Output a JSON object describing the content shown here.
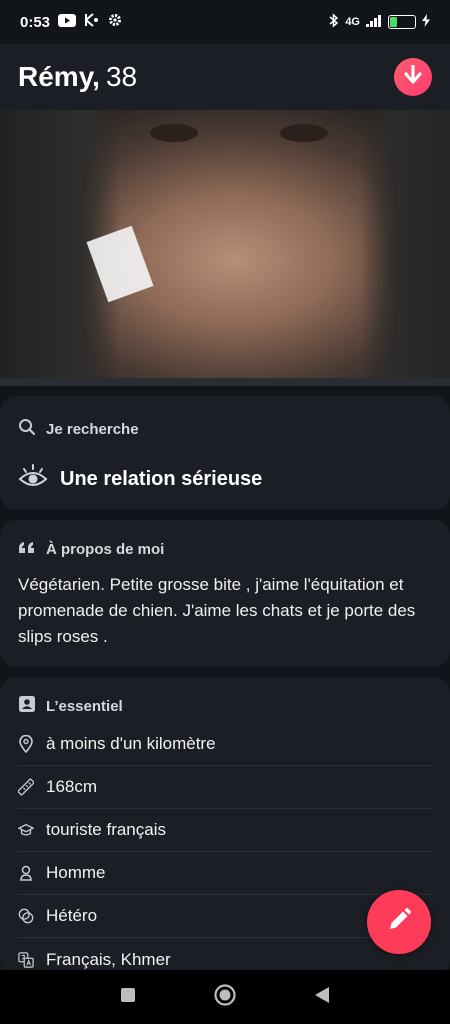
{
  "status_bar": {
    "time": "0:53",
    "network": "4G",
    "battery": "25"
  },
  "profile": {
    "name": "Rémy,",
    "age": "38"
  },
  "looking_for": {
    "label": "Je recherche",
    "value": "Une relation sérieuse"
  },
  "about": {
    "label": "À propos de moi",
    "text": " Végétarien. Petite grosse bite , j'aime l'équitation et promenade de chien. J'aime les chats et je porte des slips roses ."
  },
  "essentials": {
    "label": "L’essentiel",
    "items": [
      {
        "icon": "location-pin-icon",
        "text": "à moins d'un kilomètre"
      },
      {
        "icon": "ruler-icon",
        "text": "168cm"
      },
      {
        "icon": "graduation-cap-icon",
        "text": "touriste français"
      },
      {
        "icon": "person-icon",
        "text": "Homme"
      },
      {
        "icon": "orientation-icon",
        "text": "Hétéro"
      },
      {
        "icon": "translate-icon",
        "text": "Français, Khmer"
      }
    ]
  },
  "colors": {
    "accent": "#fe3c72",
    "background": "#111418",
    "card": "#1b1e24"
  }
}
